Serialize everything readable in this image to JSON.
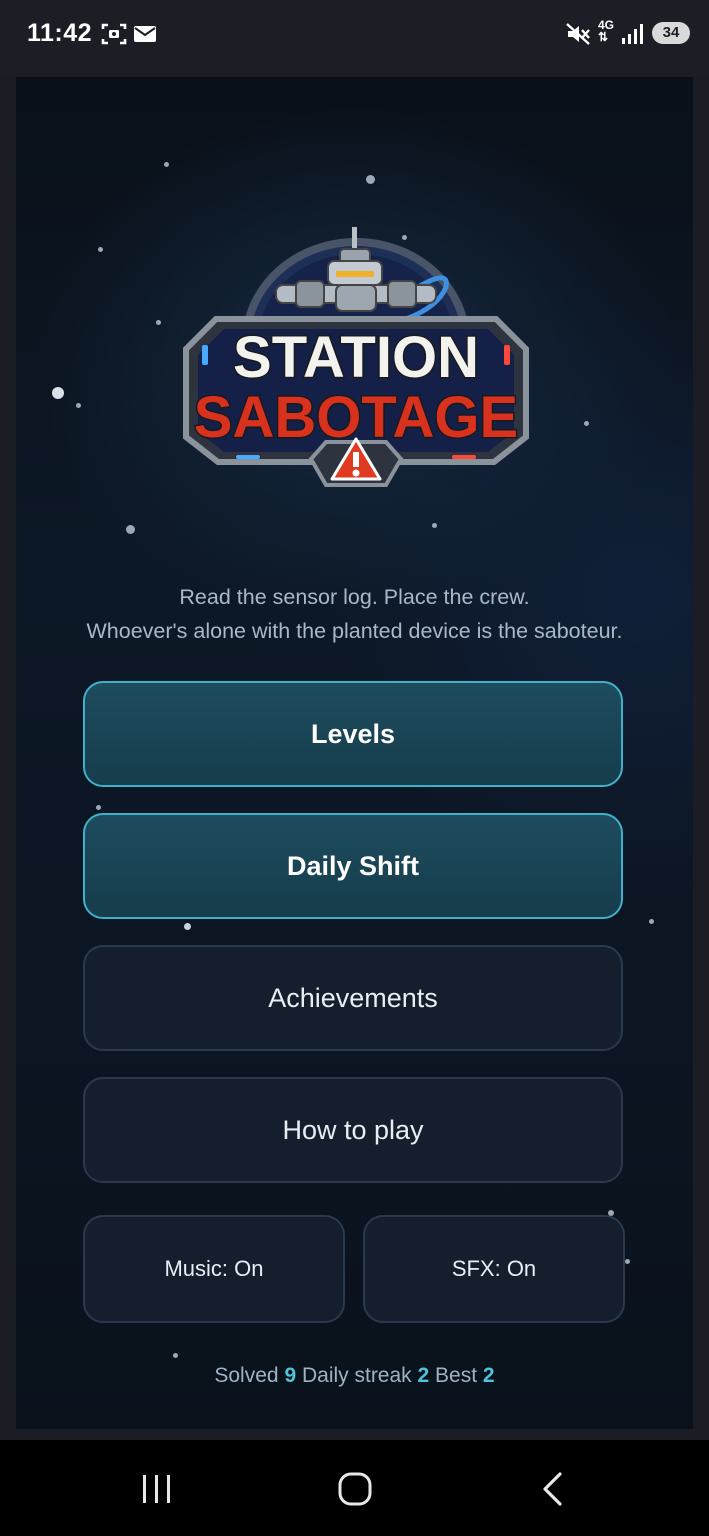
{
  "status_bar": {
    "time": "11:42",
    "icons": [
      "screenshot-icon",
      "mail-icon",
      "mute-icon",
      "4g-icon",
      "signal-icon"
    ],
    "network": "4G",
    "battery": "34"
  },
  "game": {
    "logo": {
      "line1": "STATION",
      "line2": "SABOTAGE"
    },
    "tagline": {
      "line1": "Read the sensor log. Place the crew.",
      "line2": "Whoever's alone with the planted device is the saboteur."
    },
    "menu": {
      "levels": "Levels",
      "daily_shift": "Daily Shift",
      "achievements": "Achievements",
      "how_to_play": "How to play",
      "music": "Music: On",
      "sfx": "SFX: On"
    },
    "stats": {
      "solved_label": "Solved",
      "solved_value": "9",
      "streak_label": "Daily streak",
      "streak_value": "2",
      "best_label": "Best",
      "best_value": "2"
    }
  },
  "nav": {
    "icons": [
      "recents-icon",
      "home-icon",
      "back-icon"
    ]
  },
  "colors": {
    "accent": "#3fb1c8",
    "stat_value": "#4fc3d9",
    "logo_red": "#d8321f"
  }
}
